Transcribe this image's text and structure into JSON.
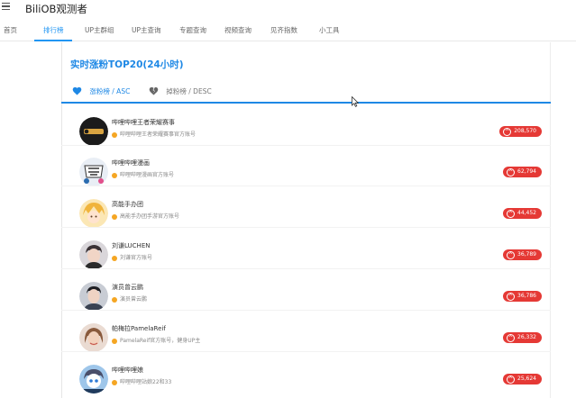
{
  "app": {
    "title": "BiliOB观测者"
  },
  "nav": {
    "tabs": [
      {
        "label": "首页"
      },
      {
        "label": "排行榜"
      },
      {
        "label": "UP主群组"
      },
      {
        "label": "UP主查询"
      },
      {
        "label": "专题查询"
      },
      {
        "label": "视频查询"
      },
      {
        "label": "见齐指数"
      },
      {
        "label": "小工具"
      }
    ],
    "active_index": 1
  },
  "section": {
    "title": "实时涨粉TOP20(24小时)",
    "tabs": [
      {
        "label": "涨粉榜 / ASC",
        "icon": "heart-icon"
      },
      {
        "label": "掉粉榜 / DESC",
        "icon": "broken-heart-icon"
      }
    ]
  },
  "list": [
    {
      "name": "哔哩哔哩王者荣耀赛事",
      "sign": "哔哩哔哩王者荣耀赛事官方账号",
      "delta": "208,570",
      "avatar_color": "#1b1b1b"
    },
    {
      "name": "哔哩哔哩漫画",
      "sign": "哔哩哔哩漫画官方账号",
      "delta": "62,794",
      "avatar_color": "#e9eef5"
    },
    {
      "name": "高能手办团",
      "sign": "高能手办团手游官方账号",
      "delta": "44,452",
      "avatar_color": "#f3c96b"
    },
    {
      "name": "刘谦LUCHEN",
      "sign": "刘谦官方账号",
      "delta": "36,789",
      "avatar_color": "#c9c5c9"
    },
    {
      "name": "演员曾云鹏",
      "sign": "演员曾云鹏",
      "delta": "36,786",
      "avatar_color": "#b8bcc6"
    },
    {
      "name": "帕梅拉PamelaReif",
      "sign": "PamelaReif官方账号，健身UP主",
      "delta": "26,332",
      "avatar_color": "#d8b6a4"
    },
    {
      "name": "哔哩哔哩娘",
      "sign": "哔哩哔哩站娘22和33",
      "delta": "25,624",
      "avatar_color": "#9ec6ea"
    }
  ],
  "colors": {
    "accent": "#1e88e5",
    "badge": "#e53935",
    "cert_dot": "#f5a623"
  }
}
